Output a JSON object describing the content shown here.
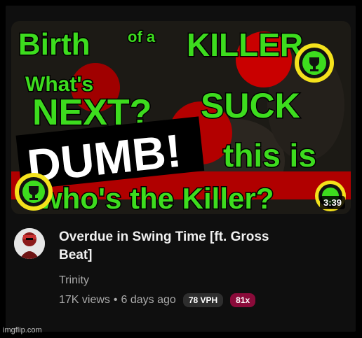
{
  "video": {
    "duration": "3:39",
    "title_line1": "Overdue in Swing Time [ft. Gross",
    "title_line2": "Beat]",
    "channel": "Trinity",
    "views": "17K views",
    "separator": "•",
    "age": "6 days ago",
    "vph_badge": "78 VPH",
    "multiplier_badge": "81x"
  },
  "thumbnail_text": {
    "birth": "Birth",
    "of_a": "of a",
    "killer": "KILLER",
    "whats": "What's",
    "next": "NEXT?",
    "suck": "SUCK",
    "dumb": "DUMB!",
    "this_is": "this is",
    "whos_the_killer": "who's the Killer?"
  },
  "colors": {
    "accent_green": "#3ddc1e",
    "accent_red": "#d40000",
    "vph_badge_bg": "#2e2e2e",
    "multiplier_badge_bg": "#8a0b3a"
  },
  "watermark": "imgflip.com"
}
